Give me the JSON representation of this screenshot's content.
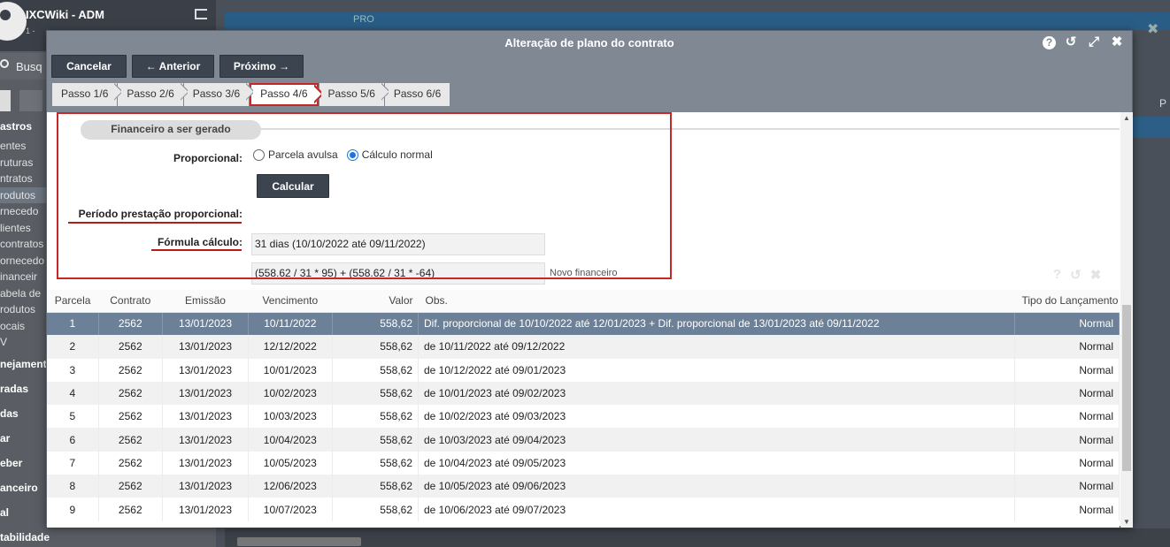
{
  "background": {
    "user_name": "IXCWiki - ADM",
    "user_sub": "1 -",
    "search_label": "Busq",
    "menu_header": "astros",
    "menu_items": [
      "entes",
      "ruturas",
      "ntratos",
      "rodutos",
      "rnecedo",
      "lientes",
      "contratos",
      "ornecedo",
      "inanceir",
      "abela de",
      "rodutos",
      "ocais",
      "V"
    ],
    "menu_sections": [
      "nejament",
      "radas",
      "das",
      "ar",
      "eber",
      "anceiro",
      "al",
      "tabilidade"
    ],
    "top_tab_label": "PRO",
    "right_label": "P"
  },
  "modal": {
    "title": "Alteração de plano do contrato",
    "toolbar": {
      "cancel": "Cancelar",
      "previous": "← Anterior",
      "next": "Próximo →"
    },
    "steps": [
      "Passo 1/6",
      "Passo 2/6",
      "Passo 3/6",
      "Passo 4/6",
      "Passo 5/6",
      "Passo 6/6"
    ],
    "active_step_index": 3,
    "section_title": "Financeiro a ser gerado",
    "proporcional_label": "Proporcional:",
    "radio_options": [
      "Parcela avulsa",
      "Cálculo normal"
    ],
    "radio_selected": "Cálculo normal",
    "calc_button": "Calcular",
    "periodo_label": "Período prestação proporcional:",
    "periodo_value": "31 dias (10/10/2022 até 09/11/2022)",
    "formula_label": "Fórmula cálculo:",
    "formula_value": "(558.62 / 31 * 95) + (558.62 / 31 * -64)",
    "novo_financeiro": "Novo financeiro"
  },
  "table": {
    "columns": [
      "Parcela",
      "Contrato",
      "Emissão",
      "Vencimento",
      "Valor",
      "Obs.",
      "Tipo do Lançamento"
    ],
    "rows": [
      [
        "1",
        "2562",
        "13/01/2023",
        "10/11/2022",
        "558,62",
        "Dif. proporcional de 10/10/2022 até 12/01/2023 + Dif. proporcional de 13/01/2023 até 09/11/2022",
        "Normal"
      ],
      [
        "2",
        "2562",
        "13/01/2023",
        "12/12/2022",
        "558,62",
        "de 10/11/2022 até 09/12/2022",
        "Normal"
      ],
      [
        "3",
        "2562",
        "13/01/2023",
        "10/01/2023",
        "558,62",
        "de 10/12/2022 até 09/01/2023",
        "Normal"
      ],
      [
        "4",
        "2562",
        "13/01/2023",
        "10/02/2023",
        "558,62",
        "de 10/01/2023 até 09/02/2023",
        "Normal"
      ],
      [
        "5",
        "2562",
        "13/01/2023",
        "10/03/2023",
        "558,62",
        "de 10/02/2023 até 09/03/2023",
        "Normal"
      ],
      [
        "6",
        "2562",
        "13/01/2023",
        "10/04/2023",
        "558,62",
        "de 10/03/2023 até 09/04/2023",
        "Normal"
      ],
      [
        "7",
        "2562",
        "13/01/2023",
        "10/05/2023",
        "558,62",
        "de 10/04/2023 até 09/05/2023",
        "Normal"
      ],
      [
        "8",
        "2562",
        "13/01/2023",
        "12/06/2023",
        "558,62",
        "de 10/05/2023 até 09/06/2023",
        "Normal"
      ],
      [
        "9",
        "2562",
        "13/01/2023",
        "10/07/2023",
        "558,62",
        "de 10/06/2023 até 09/07/2023",
        "Normal"
      ]
    ],
    "selected_row_index": 0
  },
  "colors": {
    "highlight_red": "#c62828",
    "selected_row": "#6c8197",
    "header_bar": "#7f8893",
    "dark_button": "#3c4450",
    "radio_blue": "#1a73e8"
  }
}
